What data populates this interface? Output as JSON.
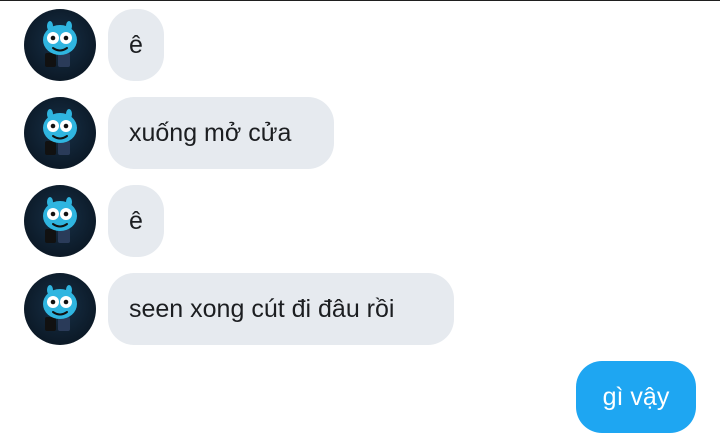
{
  "messages": [
    {
      "sender": "contact",
      "text": "ê",
      "avatar_icon": "gumball-avatar-icon"
    },
    {
      "sender": "contact",
      "text": "xuống mở cửa",
      "avatar_icon": "gumball-avatar-icon"
    },
    {
      "sender": "contact",
      "text": "ê",
      "avatar_icon": "gumball-avatar-icon"
    },
    {
      "sender": "contact",
      "text": "seen xong cút đi đâu rồi",
      "avatar_icon": "gumball-avatar-icon"
    },
    {
      "sender": "me",
      "text": "gì vậy"
    }
  ],
  "colors": {
    "incoming_bubble": "#e6eaef",
    "outgoing_bubble": "#1ea6f2",
    "text": "#1c1e21",
    "outgoing_text": "#ffffff"
  }
}
